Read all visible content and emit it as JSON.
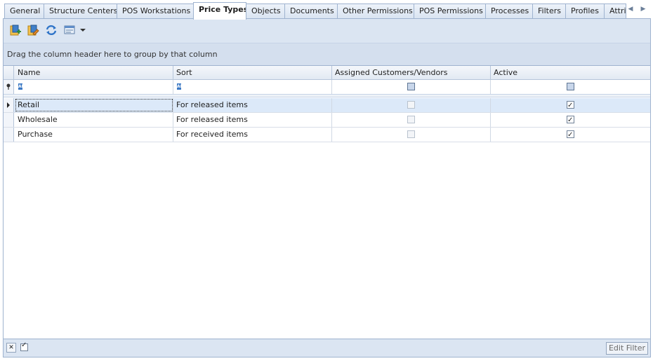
{
  "tabs": [
    {
      "label": "General"
    },
    {
      "label": "Structure Centers"
    },
    {
      "label": "POS Workstations"
    },
    {
      "label": "Price Types",
      "active": true
    },
    {
      "label": "Objects"
    },
    {
      "label": "Documents"
    },
    {
      "label": "Other Permissions"
    },
    {
      "label": "POS Permissions"
    },
    {
      "label": "Processes"
    },
    {
      "label": "Filters"
    },
    {
      "label": "Profiles"
    },
    {
      "label": "Attri"
    }
  ],
  "toolbar": {
    "icons": [
      "add-icon",
      "edit-icon",
      "refresh-icon",
      "view-icon",
      "dropdown-arrow-icon"
    ]
  },
  "grid": {
    "group_hint": "Drag the column header here to group by that column",
    "columns": {
      "name": "Name",
      "sort": "Sort",
      "assigned": "Assigned Customers/Vendors",
      "active": "Active"
    },
    "filter_text_icon": "ABC",
    "rows": [
      {
        "name": "Retail",
        "sort": "For released items",
        "assigned": false,
        "active": true,
        "selected": true
      },
      {
        "name": "Wholesale",
        "sort": "For released items",
        "assigned": false,
        "active": true
      },
      {
        "name": "Purchase",
        "sort": "For received items",
        "assigned": false,
        "active": true
      }
    ]
  },
  "footer": {
    "edit_filter_label": "Edit Filter"
  },
  "colors": {
    "accent": "#9fb3cf",
    "selected_row": "#dce9f9"
  }
}
